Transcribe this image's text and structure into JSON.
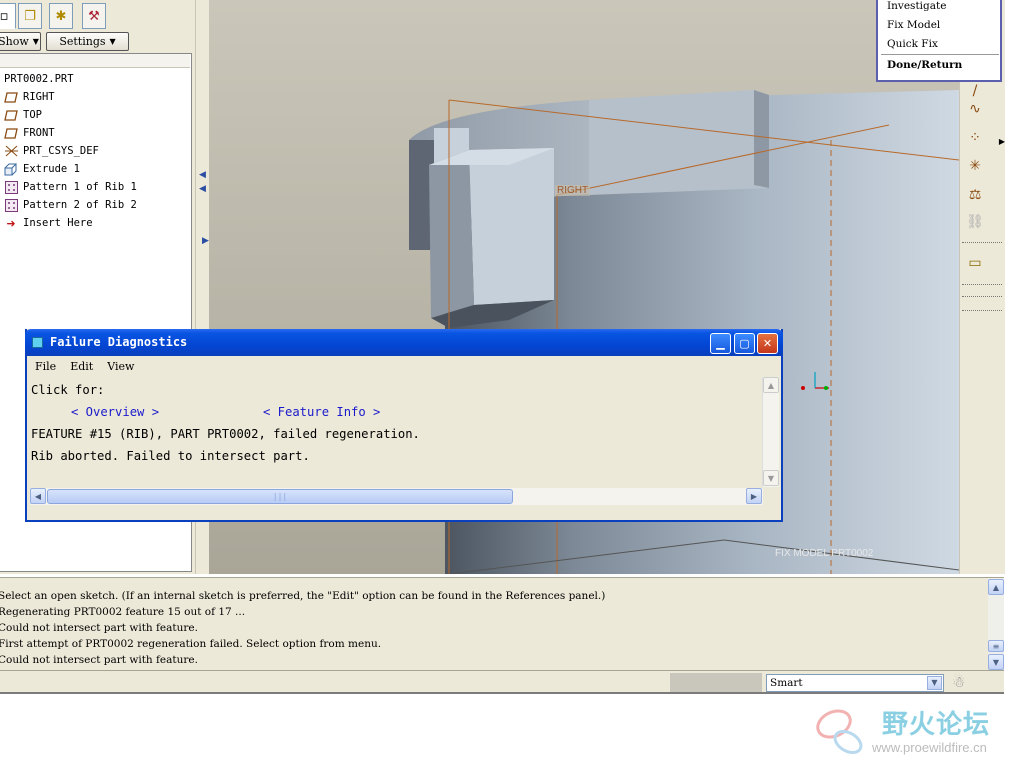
{
  "left_panel": {
    "tabs": [
      "model-tree",
      "layers",
      "favorites",
      "tools"
    ],
    "show_label": "Show",
    "settings_label": "Settings",
    "tree": {
      "root": "PRT0002.PRT",
      "items": [
        {
          "label": "RIGHT",
          "icon": "datum-plane-icon"
        },
        {
          "label": "TOP",
          "icon": "datum-plane-icon"
        },
        {
          "label": "FRONT",
          "icon": "datum-plane-icon"
        },
        {
          "label": "PRT_CSYS_DEF",
          "icon": "csys-icon"
        },
        {
          "label": "Extrude 1",
          "icon": "extrude-icon"
        },
        {
          "label": "Pattern 1 of Rib 1",
          "icon": "pattern-icon"
        },
        {
          "label": "Pattern 2 of Rib 2",
          "icon": "pattern-icon"
        },
        {
          "label": "Insert Here",
          "icon": "insert-arrow-icon"
        }
      ]
    }
  },
  "viewport": {
    "datum_label": "RIGHT",
    "mode_label": "FIX MODEL PRT0002"
  },
  "menu_manager": {
    "items": [
      "Investigate",
      "Fix Model",
      "Quick Fix"
    ],
    "done_label": "Done/Return"
  },
  "dialog": {
    "title": "Failure Diagnostics",
    "menu": [
      "File",
      "Edit",
      "View"
    ],
    "click_for": "Click for:",
    "link_overview": "< Overview >",
    "link_feature_info": "< Feature Info >",
    "line1": "FEATURE #15 (RIB), PART PRT0002, failed regeneration.",
    "line2": "Rib aborted. Failed to intersect part."
  },
  "messages": [
    "Select an open sketch. (If an internal sketch is preferred, the \"Edit\" option can be found in the References panel.)",
    "Regenerating PRT0002 feature 15 out of 17 ...",
    "Could not intersect part with feature.",
    "First attempt of PRT0002 regeneration failed. Select option from menu.",
    "Could not intersect part with feature."
  ],
  "status_bar": {
    "filter_value": "Smart"
  },
  "watermark": {
    "text": "野火论坛",
    "url": "www.proewildfire.cn"
  },
  "colors": {
    "title_blue": "#0a55e3",
    "link_blue": "#1a1acc",
    "datum_orange": "#b8692a"
  }
}
